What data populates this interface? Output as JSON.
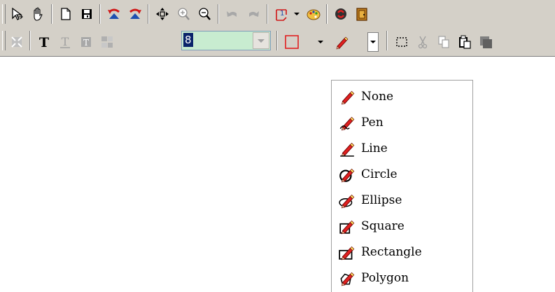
{
  "toolbar_top": {
    "buttons": [
      {
        "name": "select-arrow-button",
        "icon": "select-arrow-icon"
      },
      {
        "name": "pan-hand-button",
        "icon": "hand-icon"
      },
      {
        "name": "new-document-button",
        "icon": "new-document-icon"
      },
      {
        "name": "save-button",
        "icon": "floppy-disk-icon"
      },
      {
        "name": "rotate-left-button",
        "icon": "rotate-left-icon"
      },
      {
        "name": "rotate-right-button",
        "icon": "rotate-right-icon"
      },
      {
        "name": "move-button",
        "icon": "four-arrows-icon"
      },
      {
        "name": "zoom-in-button",
        "icon": "zoom-in-icon"
      },
      {
        "name": "zoom-out-button",
        "icon": "zoom-out-icon"
      },
      {
        "name": "undo-button",
        "icon": "undo-icon"
      },
      {
        "name": "redo-button",
        "icon": "redo-icon"
      },
      {
        "name": "page-number-button",
        "icon": "page-number-icon",
        "label": "1"
      },
      {
        "name": "palette-button",
        "icon": "palette-icon"
      },
      {
        "name": "recycle-button",
        "icon": "recycle-icon"
      },
      {
        "name": "exit-button",
        "icon": "exit-door-icon"
      }
    ]
  },
  "toolbar_bottom": {
    "font_size_value": "8",
    "buttons": [
      {
        "name": "fit-button",
        "icon": "fit-arrows-icon"
      },
      {
        "name": "text-button",
        "icon": "text-t-icon",
        "label": "T"
      },
      {
        "name": "text-outline-button",
        "icon": "text-underline-icon"
      },
      {
        "name": "text-box-button",
        "icon": "text-box-icon"
      },
      {
        "name": "font-tool-button",
        "icon": "font-tool-icon"
      },
      {
        "name": "color-button",
        "icon": "color-swatch-icon"
      },
      {
        "name": "draw-tool-button",
        "icon": "pencil-icon"
      },
      {
        "name": "selection-button",
        "icon": "dashed-rectangle-icon"
      },
      {
        "name": "cut-button",
        "icon": "scissors-icon"
      },
      {
        "name": "copy-button",
        "icon": "copy-icon"
      },
      {
        "name": "paste-button",
        "icon": "paste-icon"
      },
      {
        "name": "fill-button",
        "icon": "fill-icon"
      }
    ],
    "colors": {
      "swatch_border": "#e02020",
      "accent": "#0a246a",
      "font_box_bg": "#c8ecd0"
    }
  },
  "draw_menu": {
    "items": [
      {
        "label": "None",
        "icon": "pencil-icon"
      },
      {
        "label": "Pen",
        "icon": "pen-icon"
      },
      {
        "label": "Line",
        "icon": "pencil-line-icon"
      },
      {
        "label": "Circle",
        "icon": "pencil-circle-icon"
      },
      {
        "label": "Ellipse",
        "icon": "pencil-ellipse-icon"
      },
      {
        "label": "Square",
        "icon": "pencil-square-icon"
      },
      {
        "label": "Rectangle",
        "icon": "pencil-rectangle-icon"
      },
      {
        "label": "Polygon",
        "icon": "pencil-polygon-icon"
      }
    ]
  }
}
